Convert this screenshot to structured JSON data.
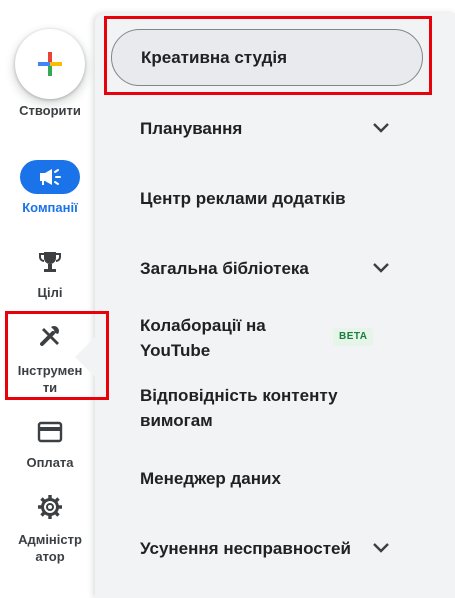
{
  "rail": {
    "create_label": "Створити",
    "campaigns_label": "Компанії",
    "goals_label": "Цілі",
    "tools_label_line1": "Інструмен",
    "tools_label_line2": "ти",
    "billing_label": "Оплата",
    "admin_label_line1": "Адміністр",
    "admin_label_line2": "атор",
    "active_color": "#1a73e8"
  },
  "panel": {
    "creative_studio": "Креативна студія",
    "planning": "Планування",
    "app_ads_hub": "Центр реклами додатків",
    "shared_library": "Загальна бібліотека",
    "youtube_collab_line1": "Колаборації на",
    "youtube_collab_line2": "YouTube",
    "beta_badge": "BETA",
    "content_suitability_line1": "Відповідність контенту",
    "content_suitability_line2": "вимогам",
    "data_manager": "Менеджер даних",
    "troubleshooting": "Усунення несправностей"
  },
  "icons": [
    "plus-icon",
    "campaign-icon",
    "trophy-icon",
    "tools-icon",
    "credit-card-icon",
    "gear-icon",
    "chevron-down-icon"
  ],
  "highlight_color": "#e8000b"
}
